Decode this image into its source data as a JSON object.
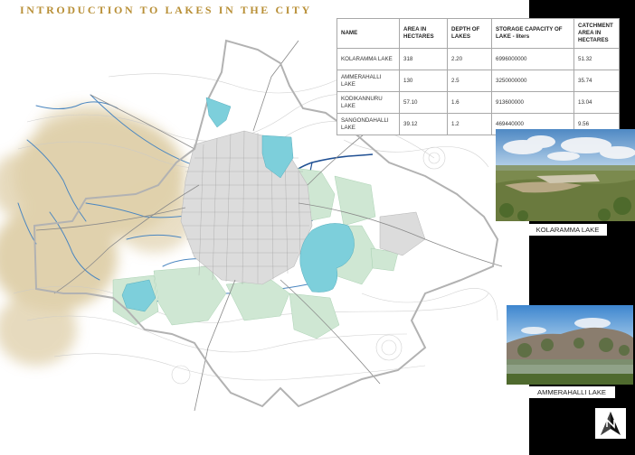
{
  "title": "INTRODUCTION TO LAKES IN THE CITY",
  "table": {
    "headers": [
      "NAME",
      "AREA IN HECTARES",
      "DEPTH OF LAKES",
      "STORAGE CAPACITY OF LAKE - liters",
      "CATCHMENT AREA IN HECTARES"
    ],
    "rows": [
      [
        "KOLARAMMA LAKE",
        "318",
        "2.20",
        "6996000000",
        "51.32"
      ],
      [
        "AMMERAHALLI LAKE",
        "130",
        "2.5",
        "3250000000",
        "35.74"
      ],
      [
        "KODIKANNURU LAKE",
        "57.10",
        "1.6",
        "913600000",
        "13.04"
      ],
      [
        "SANGONDAHALLI LAKE",
        "39.12",
        "1.2",
        "469440000",
        "9.56"
      ]
    ]
  },
  "photos": [
    {
      "caption": "KOLARAMMA LAKE"
    },
    {
      "caption": "AMMERAHALLI LAKE"
    }
  ],
  "map": {
    "lake_color": "#7dcfdb",
    "green_color": "#cfe7d3",
    "terrain_color": "#d6c292",
    "river_color": "#4a86c0",
    "river_dark_color": "#1f4f93"
  },
  "north_arrow_icon": "north-arrow-icon"
}
